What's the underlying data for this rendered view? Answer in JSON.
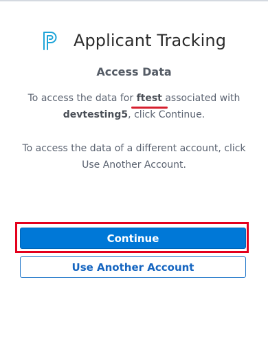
{
  "app": {
    "title": "Applicant Tracking",
    "logo_icon": "powerschool-p-logo-icon"
  },
  "access": {
    "heading": "Access Data",
    "line1_prefix": "To access the data for ",
    "account_name": "ftest",
    "line1_middle": " associated with",
    "user_name": "devtesting5",
    "line1_suffix": ", click Continue.",
    "line2": "To access the data of a different account, click Use Another Account."
  },
  "buttons": {
    "continue_label": "Continue",
    "use_another_label": "Use Another Account"
  },
  "colors": {
    "primary": "#0078d7",
    "highlight": "#e4001c",
    "logo": "#1ea4d8"
  }
}
